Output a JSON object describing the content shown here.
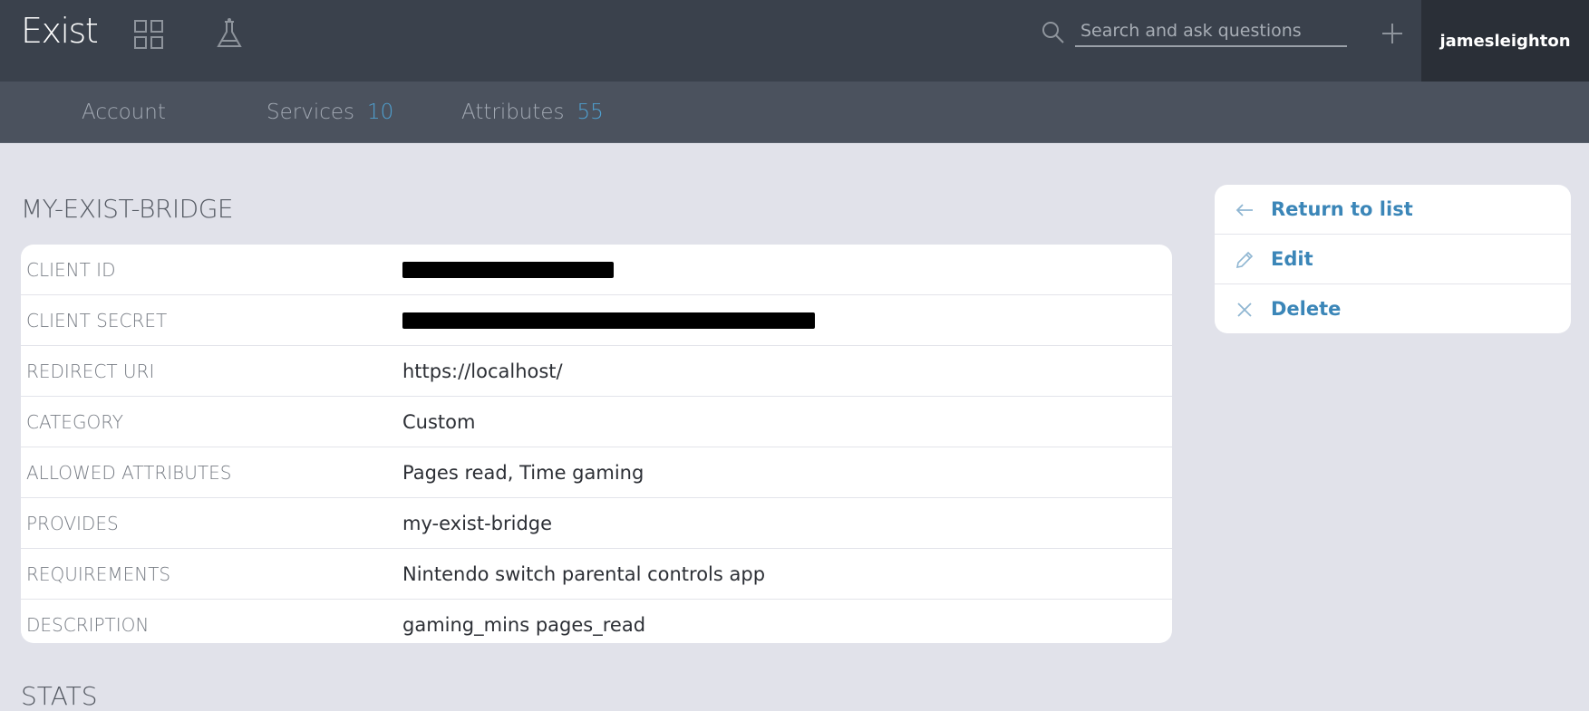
{
  "header": {
    "logo": "Exist",
    "apps_icon": "grid-icon",
    "lab_icon": "flask-icon",
    "search": {
      "placeholder": "Search and ask questions",
      "value": ""
    },
    "add_icon": "plus-icon",
    "username": "jamesleighton"
  },
  "subnav": {
    "items": [
      {
        "label": "Account",
        "count": ""
      },
      {
        "label": "Services",
        "count": "10"
      },
      {
        "label": "Attributes",
        "count": "55"
      }
    ]
  },
  "page": {
    "title": "MY-EXIST-BRIDGE",
    "stats_heading": "STATS"
  },
  "details": {
    "client_id": {
      "label": "CLIENT ID",
      "value_redacted": true
    },
    "client_secret": {
      "label": "CLIENT SECRET",
      "value_redacted": true
    },
    "redirect_uri": {
      "label": "REDIRECT URI",
      "value": "https://localhost/"
    },
    "category": {
      "label": "CATEGORY",
      "value": "Custom"
    },
    "allowed_attributes": {
      "label": "ALLOWED ATTRIBUTES",
      "value": "Pages read, Time gaming"
    },
    "provides": {
      "label": "PROVIDES",
      "value": "my-exist-bridge"
    },
    "requirements": {
      "label": "REQUIREMENTS",
      "value": "Nintendo switch parental controls app"
    },
    "description": {
      "label": "DESCRIPTION",
      "value": "gaming_mins pages_read"
    }
  },
  "actions": {
    "return": {
      "label": "Return to list",
      "icon": "arrow-left-icon"
    },
    "edit": {
      "label": "Edit",
      "icon": "pencil-icon"
    },
    "delete": {
      "label": "Delete",
      "icon": "close-icon"
    }
  },
  "colors": {
    "topbar": "#3a414c",
    "subnav": "#4b525e",
    "background": "#e1e2ea",
    "accent": "#3b86b8",
    "count": "#4fa0d0"
  }
}
